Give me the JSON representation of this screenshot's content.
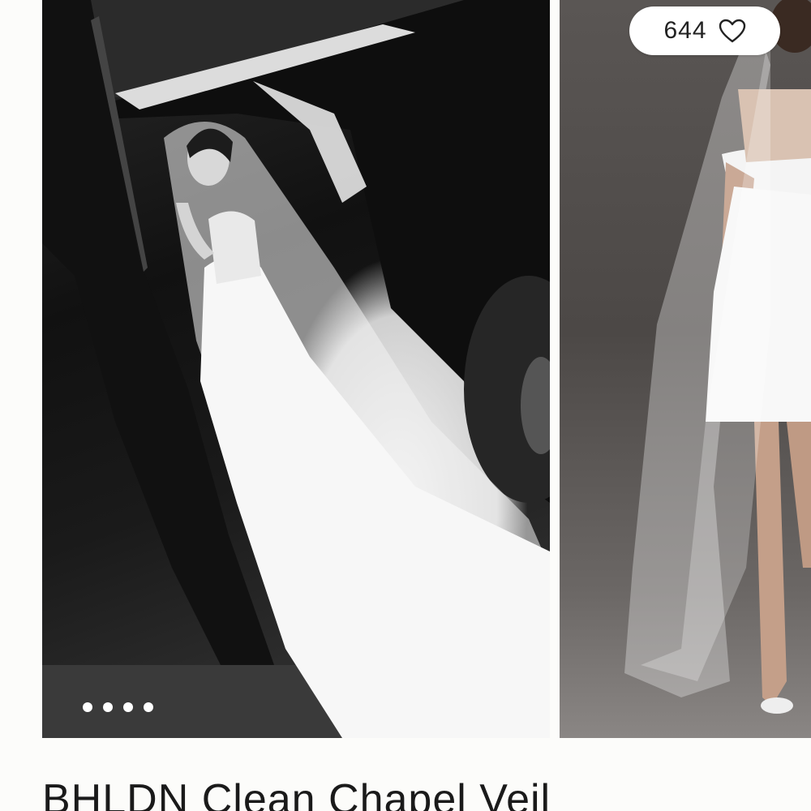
{
  "gallery": {
    "like_count": "644",
    "like_icon": "heart-outline-icon",
    "dots_count": 4,
    "main_photo": "bride-exiting-car-photo",
    "second_photo": "model-wearing-veil-photo"
  },
  "product": {
    "title": "BHLDN Clean Chapel Veil"
  },
  "colors": {
    "background": "#fcfcfa",
    "pill": "#ffffff",
    "text": "#1a1a1a"
  }
}
